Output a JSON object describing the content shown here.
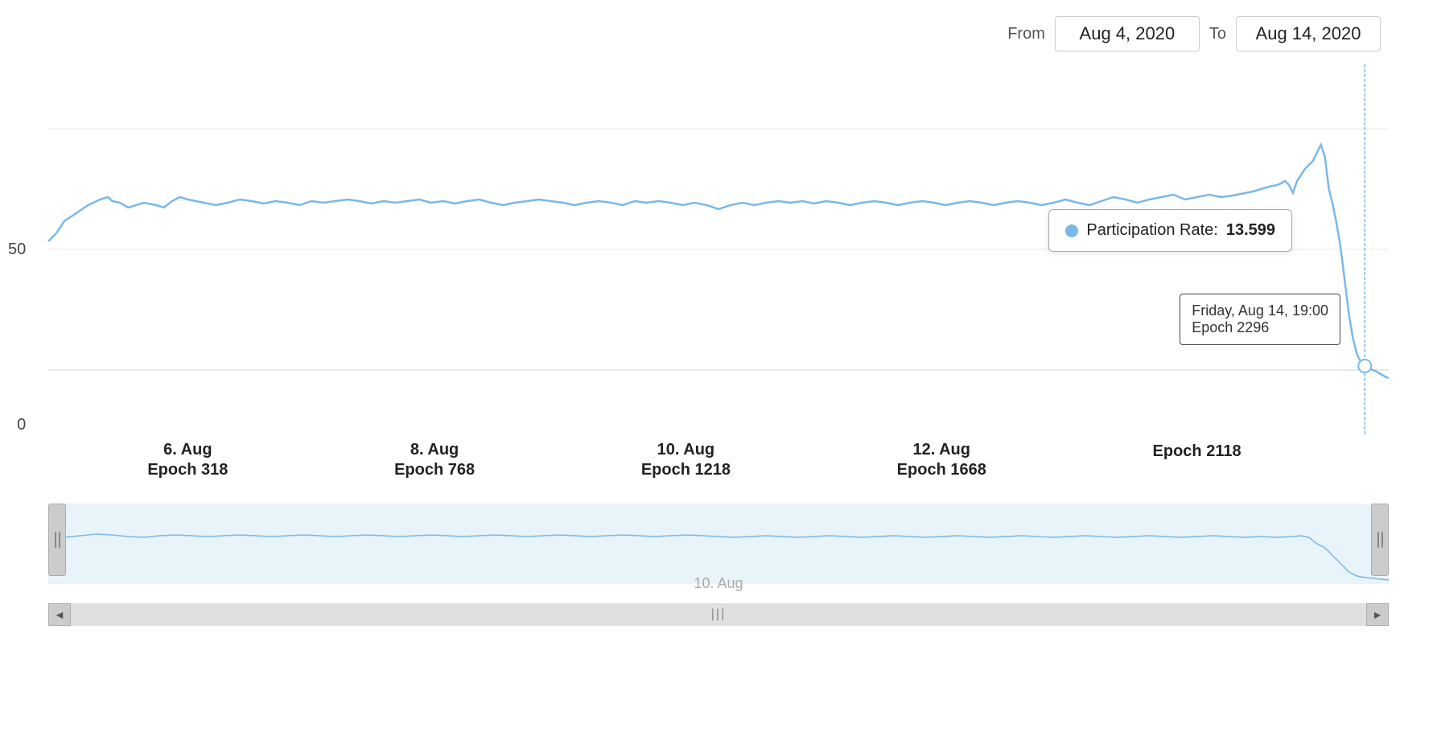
{
  "dateRange": {
    "from_label": "From",
    "to_label": "To",
    "from_value": "Aug 4, 2020",
    "to_value": "Aug 14, 2020"
  },
  "yAxis": {
    "top": "",
    "mid": "50",
    "bottom": "0"
  },
  "xAxis": {
    "labels": [
      {
        "date": "6. Aug",
        "epoch": "Epoch 318"
      },
      {
        "date": "8. Aug",
        "epoch": "Epoch 768"
      },
      {
        "date": "10. Aug",
        "epoch": "Epoch 1218"
      },
      {
        "date": "12. Aug",
        "epoch": "Epoch 1668"
      },
      {
        "date": "",
        "epoch": "Epoch 2118"
      }
    ]
  },
  "tooltip": {
    "label": "Participation Rate:",
    "value": "13.599",
    "date_line1": "Friday, Aug 14, 19:00",
    "date_line2": "Epoch 2296"
  },
  "miniChart": {
    "label": "10. Aug"
  },
  "scrollbar": {
    "left_arrow": "◄",
    "right_arrow": "►",
    "thumb_label": "|||"
  }
}
